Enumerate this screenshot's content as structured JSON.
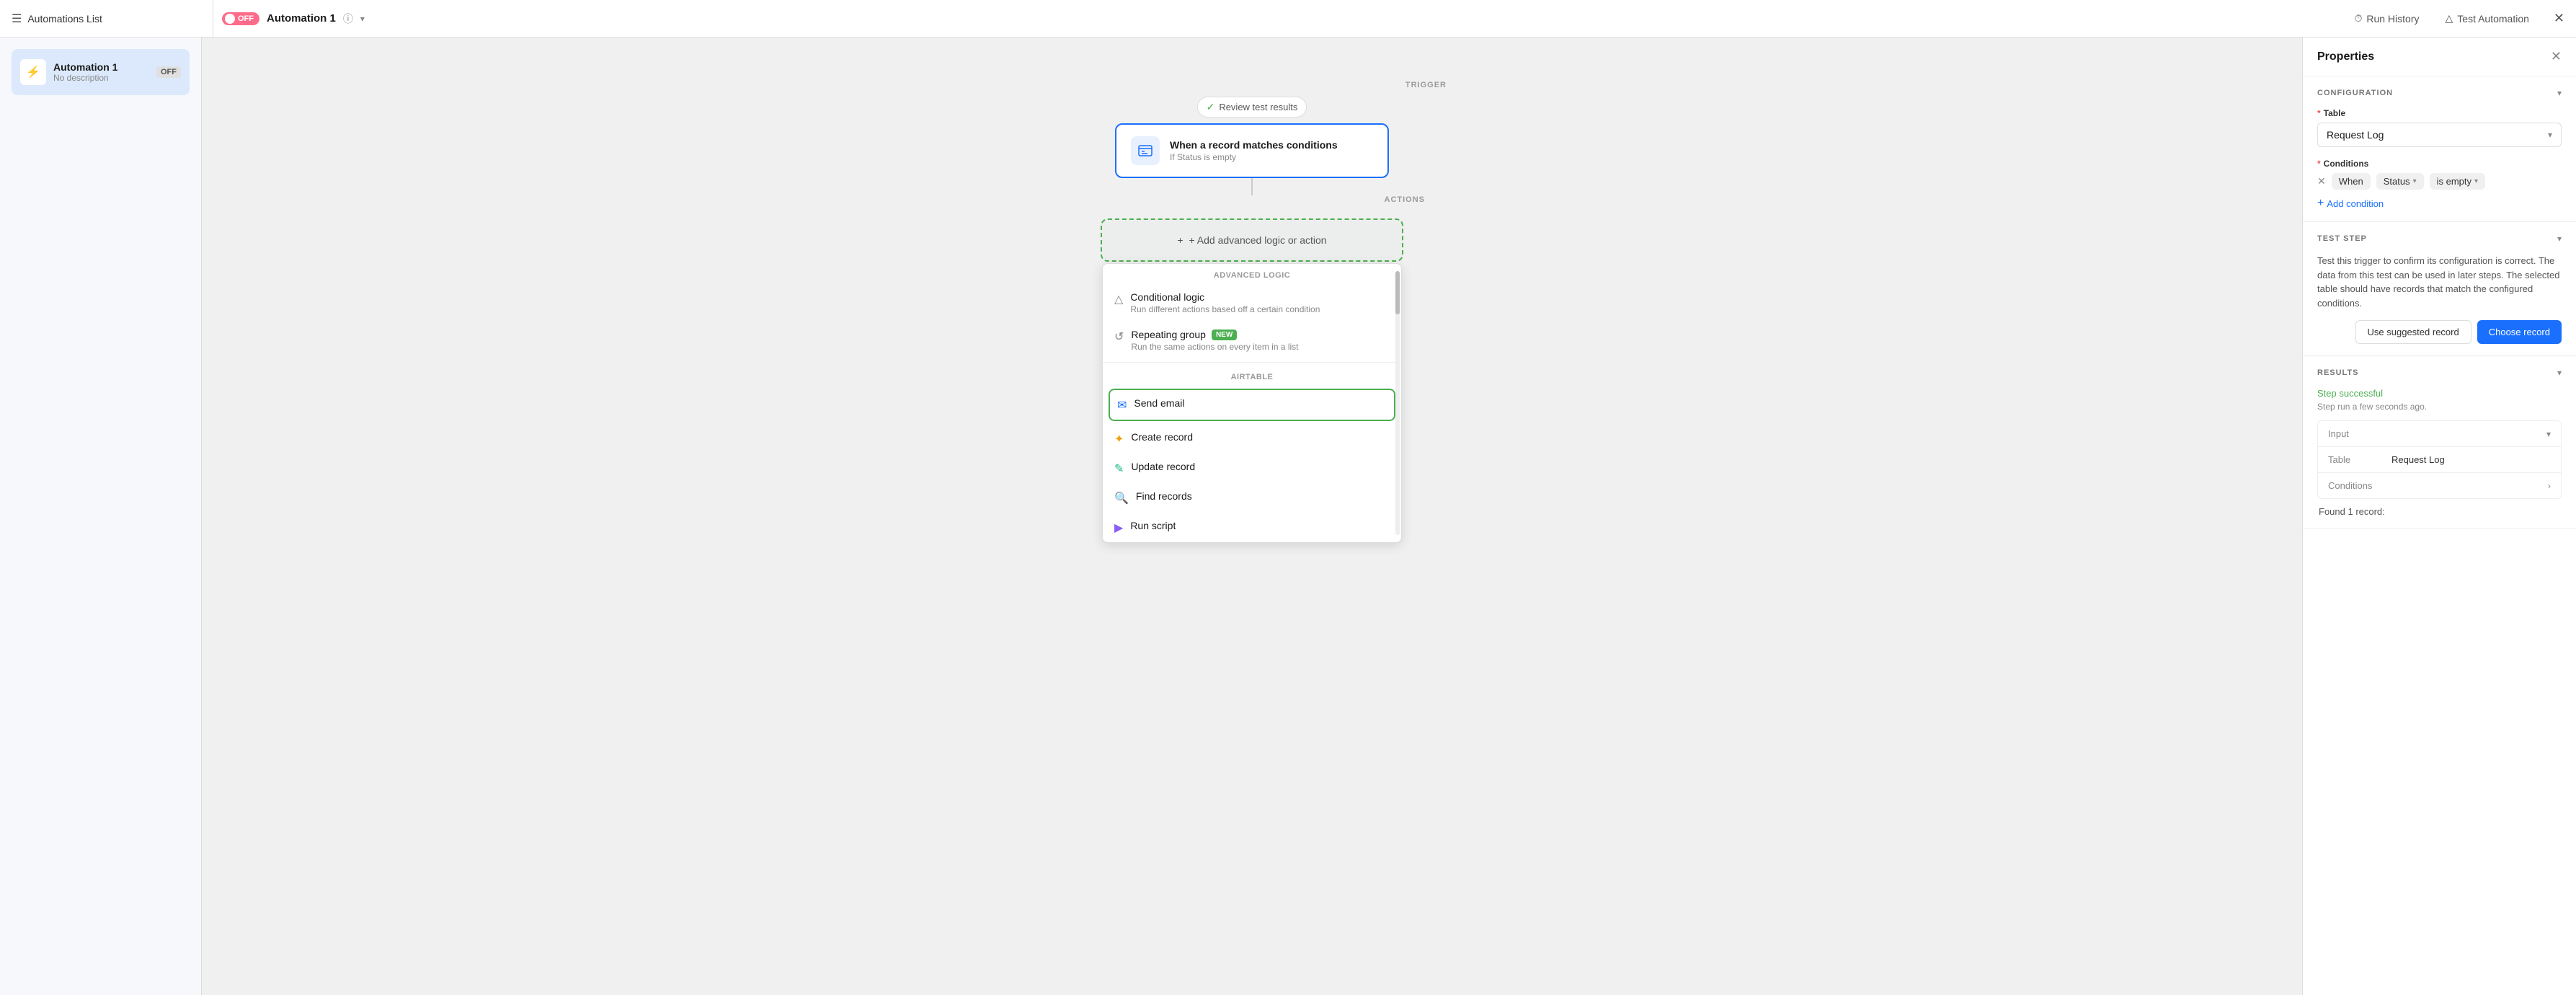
{
  "topbar": {
    "menu_label": "Automations List",
    "automation_toggle": "OFF",
    "automation_name": "Automation 1",
    "run_history_label": "Run History",
    "test_automation_label": "Test Automation"
  },
  "sidebar": {
    "automation_title": "Automation 1",
    "automation_desc": "No description",
    "automation_status": "OFF"
  },
  "canvas": {
    "trigger_section_label": "TRIGGER",
    "review_badge_label": "Review test results",
    "trigger_title": "When a record matches conditions",
    "trigger_subtitle": "If Status is empty",
    "actions_section_label": "ACTIONS",
    "add_action_label": "+ Add advanced logic or action",
    "dropdown": {
      "advanced_logic_section": "Advanced Logic",
      "conditional_logic_title": "Conditional logic",
      "conditional_logic_desc": "Run different actions based off a certain condition",
      "repeating_group_title": "Repeating group",
      "repeating_group_badge": "NEW",
      "repeating_group_desc": "Run the same actions on every item in a list",
      "airtable_section": "Airtable",
      "send_email_title": "Send email",
      "create_record_title": "Create record",
      "update_record_title": "Update record",
      "find_records_title": "Find records",
      "run_script_title": "Run script"
    }
  },
  "properties": {
    "title": "Properties",
    "config_section": "CONFIGURATION",
    "table_label": "Table",
    "table_value": "Request Log",
    "conditions_label": "Conditions",
    "condition_when": "When",
    "condition_field": "Status",
    "condition_op": "is empty",
    "add_condition_label": "Add condition",
    "test_step_section": "TEST STEP",
    "test_step_desc": "Test this trigger to confirm its configuration is correct. The data from this test can be used in later steps. The selected table should have records that match the configured conditions.",
    "use_suggested_label": "Use suggested record",
    "choose_record_label": "Choose record",
    "results_section": "RESULTS",
    "results_status": "Step successful",
    "results_time": "Step run a few seconds ago.",
    "input_label": "Input",
    "table_key": "Table",
    "table_result_val": "Request Log",
    "conditions_key": "Conditions",
    "found_record": "Found 1 record:"
  }
}
